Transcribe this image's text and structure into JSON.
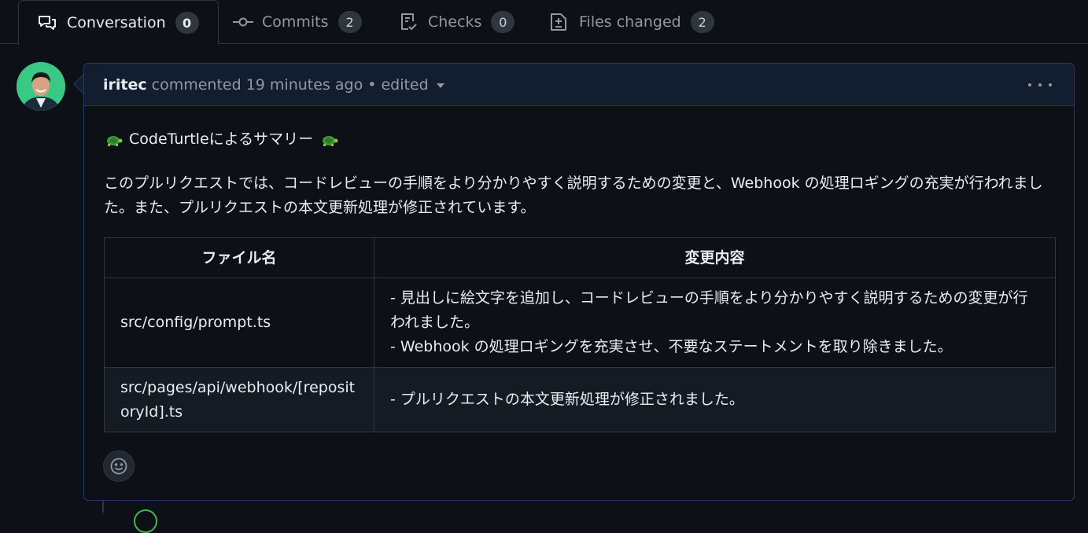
{
  "tabs": [
    {
      "label": "Conversation",
      "count": "0",
      "icon": "conversation-icon"
    },
    {
      "label": "Commits",
      "count": "2",
      "icon": "commit-icon"
    },
    {
      "label": "Checks",
      "count": "0",
      "icon": "checks-icon"
    },
    {
      "label": "Files changed",
      "count": "2",
      "icon": "file-diff-icon"
    }
  ],
  "comment": {
    "author": "iritec",
    "meta": "commented 19 minutes ago",
    "edited": "• edited",
    "title_text": "CodeTurtleによるサマリー",
    "paragraph": "このプルリクエストでは、コードレビューの手順をより分かりやすく説明するための変更と、Webhook の処理ロギングの充実が行われました。また、プルリクエストの本文更新処理が修正されています。",
    "table": {
      "headers": [
        "ファイル名",
        "変更内容"
      ],
      "rows": [
        {
          "file": "src/config/prompt.ts",
          "changes": [
            "- 見出しに絵文字を追加し、コードレビューの手順をより分かりやすく説明するための変更が行われました。",
            "- Webhook の処理ロギングを充実させ、不要なステートメントを取り除きました。"
          ]
        },
        {
          "file": "src/pages/api/webhook/[repositoryId].ts",
          "changes": [
            "- プルリクエストの本文更新処理が修正されました。"
          ]
        }
      ]
    }
  },
  "colors": {
    "background": "#0d1117",
    "header": "#121d2f",
    "border": "#30363d",
    "accent_border": "#253a5e",
    "muted_text": "#9198a1",
    "avatar_bg": "#39c985"
  }
}
